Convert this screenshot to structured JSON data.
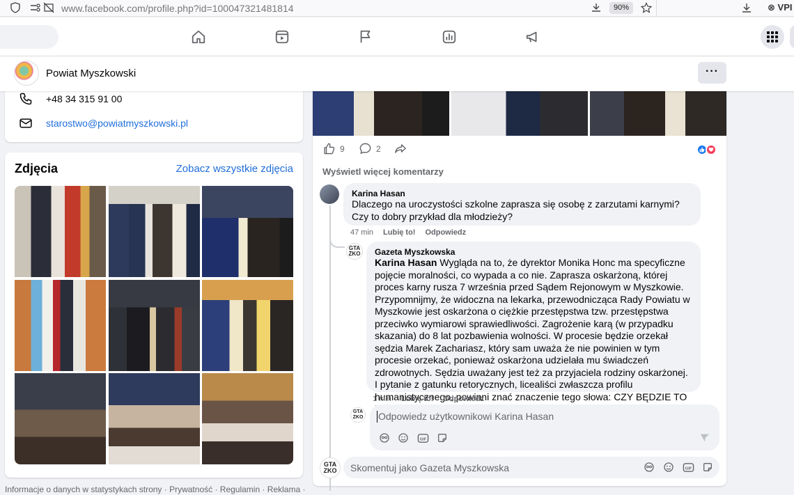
{
  "browser": {
    "url_domain": "www.facebook.com",
    "url_path": "/profile.php?id=100047321481814",
    "zoom": "90%",
    "vpn_label": "VPI"
  },
  "page": {
    "name": "Powiat Myszkowski"
  },
  "contact": {
    "phone": "+48 34 315 91 00",
    "email": "starostwo@powiatmyszkowski.pl"
  },
  "photos": {
    "title": "Zdjęcia",
    "see_all": "Zobacz wszystkie zdjęcia"
  },
  "post": {
    "likes": "9",
    "comments": "2",
    "view_more": "Wyświetl więcej komentarzy"
  },
  "comments": [
    {
      "author": "Karina Hasan",
      "text": "Dlaczego na uroczystości szkolne zaprasza się osobę z zarzutami karnymi? Czy to dobry przykład dla młodzieży?",
      "time": "47 min",
      "like": "Lubię to!",
      "reply": "Odpowiedz"
    },
    {
      "author": "Gazeta Myszkowska",
      "mention": "Karina Hasan",
      "text": " Wygląda na to, że dyrektor Monika Honc ma specyficzne pojęcie moralności, co wypada a co nie. Zaprasza oskarżoną, której proces karny rusza 7 września przed Sądem Rejonowym w Myszkowie. Przypomnijmy, że widoczna na lekarka, przewodnicząca Rady Powiatu w Myszkowie jest oskarżona o ciężkie przestępstwa tzw. przestępstwa przeciwko wymiarowi sprawiedliwości. Zagrożenie karą (w przypadku skazania) do 8 lat pozbawienia wolności. W procesie będzie orzekał sędzia Marek Zachariasz, który sam uważa że nie powinien w tym procesie orzekać, ponieważ oskarżona udzielała mu świadczeń zdrowotnych. Sędzia uważany jest też za przyjaciela rodziny oskarżonej. I pytanie z gatunku retorycznych, licealiści zwłaszcza profilu humanistycznego, powinni znać znaczenie tego słowa: CZY BĘDZIE TO UCZCIWY PROCES?",
      "time": "1 min",
      "like": "Lubię to!",
      "reply": "Odpowiedz"
    }
  ],
  "reply_input": {
    "placeholder": "Odpowiedz użytkownikowi Karina Hasan"
  },
  "comment_input": {
    "placeholder": "Skomentuj jako Gazeta Myszkowska"
  },
  "avatar_text": {
    "gm_line1": "GTA",
    "gm_line2": "ZKO"
  },
  "footer": "Informacje o danych w statystykach strony · Prywatność · Regulamin · Reklama ·",
  "colors": {
    "link": "#216fdb",
    "like_blue": "#1877f2",
    "love_red": "#f33e58"
  }
}
